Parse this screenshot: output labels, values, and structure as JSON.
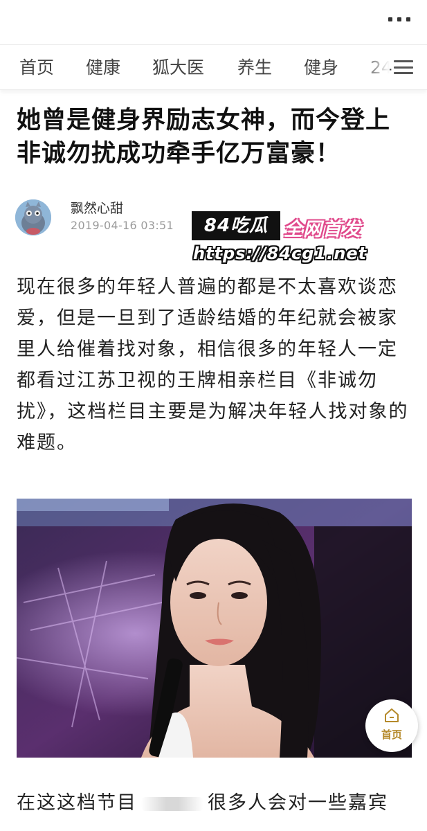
{
  "nav": {
    "tabs": [
      "首页",
      "健康",
      "狐大医",
      "养生",
      "健身",
      "24"
    ]
  },
  "article": {
    "title_line1": "她曾是健身界励志女神，而今登上",
    "title_line2": "非诚勿扰成功牵手亿万富豪！",
    "author": "飘然心甜",
    "date": "2019-04-16 03:51",
    "paragraph": "现在很多的年轻人普遍的都是不太喜欢谈恋爱，但是一旦到了适龄结婚的年纪就会被家里人给催着找对象，相信很多的年轻人一定都看过江苏卫视的王牌相亲栏目《非诚勿扰》，这档栏目主要是为解决年轻人找对象的难题。",
    "bottom_start": "在这这档节目",
    "bottom_end": "很多人会对一些嘉宾"
  },
  "watermark": {
    "badge": "84吃瓜",
    "first": "全网首发",
    "url": "https://84cg1.net"
  },
  "home_button": {
    "label": "首页"
  },
  "icons": {
    "more": "more-dots-icon",
    "menu": "menu-lines-icon",
    "home": "home-icon"
  }
}
